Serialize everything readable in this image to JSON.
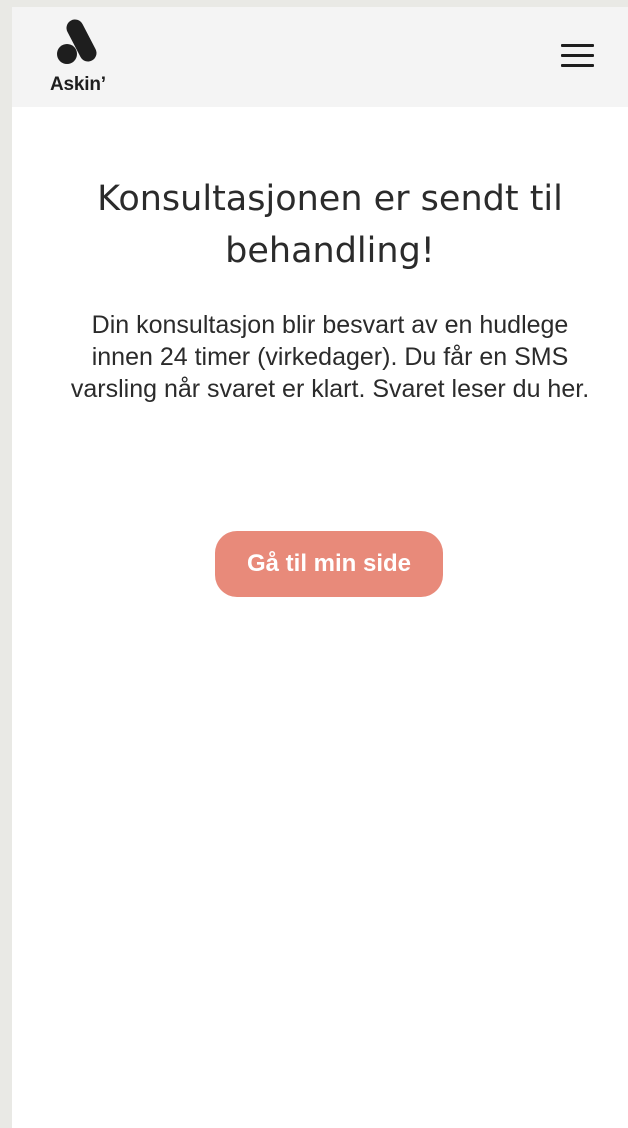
{
  "header": {
    "logo_text": "Askin’",
    "menu_icon": "hamburger-menu-icon"
  },
  "main": {
    "title": "Konsultasjonen er sendt til behandling!",
    "description": "Din konsultasjon blir besvart av en hudlege innen 24 timer (virkedager). Du får en SMS varsling når svaret er klart. Svaret leser du her.",
    "cta_label": "Gå til min side"
  },
  "colors": {
    "header_background": "#f4f4f4",
    "page_background": "#ffffff",
    "outer_background": "#e9e9e5",
    "button_background": "#e88a7a",
    "button_text": "#ffffff",
    "text": "#2b2b2b"
  }
}
